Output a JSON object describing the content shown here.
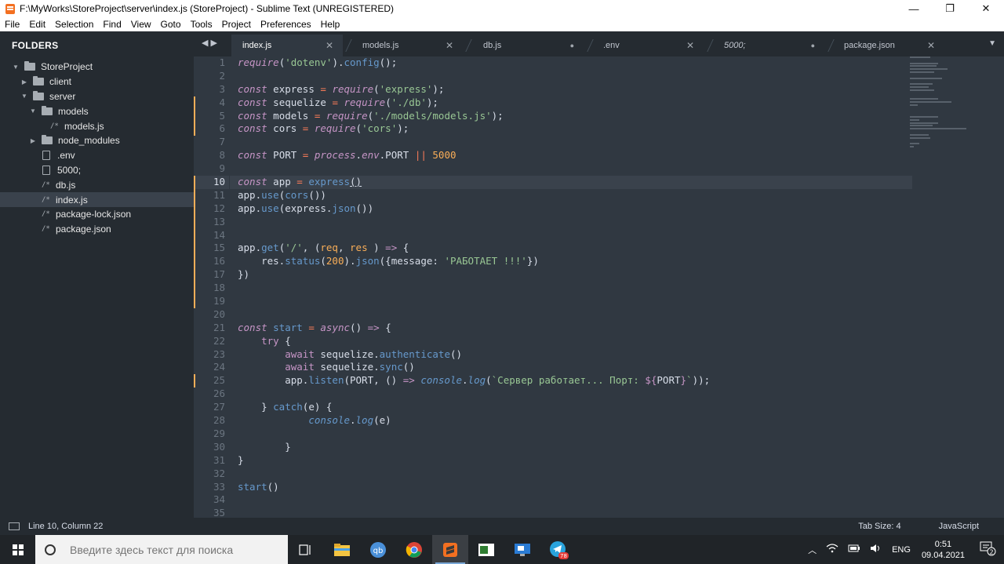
{
  "window": {
    "title": "F:\\MyWorks\\StoreProject\\server\\index.js (StoreProject) - Sublime Text (UNREGISTERED)",
    "minimize": "—",
    "restore": "❐",
    "close": "✕"
  },
  "menu": [
    "File",
    "Edit",
    "Selection",
    "Find",
    "View",
    "Goto",
    "Tools",
    "Project",
    "Preferences",
    "Help"
  ],
  "sidebar": {
    "header": "FOLDERS",
    "items": [
      {
        "label": "StoreProject",
        "type": "folder",
        "open": true,
        "indent": 0
      },
      {
        "label": "client",
        "type": "folder",
        "open": false,
        "indent": 1
      },
      {
        "label": "server",
        "type": "folder",
        "open": true,
        "indent": 1
      },
      {
        "label": "models",
        "type": "folder",
        "open": true,
        "indent": 2
      },
      {
        "label": "models.js",
        "type": "js",
        "indent": 3
      },
      {
        "label": "node_modules",
        "type": "folder",
        "open": false,
        "indent": 2
      },
      {
        "label": ".env",
        "type": "file",
        "indent": 2
      },
      {
        "label": "5000;",
        "type": "file",
        "indent": 2
      },
      {
        "label": "db.js",
        "type": "js",
        "indent": 2
      },
      {
        "label": "index.js",
        "type": "js",
        "indent": 2,
        "active": true
      },
      {
        "label": "package-lock.json",
        "type": "js",
        "indent": 2
      },
      {
        "label": "package.json",
        "type": "js",
        "indent": 2
      }
    ]
  },
  "tabs": {
    "nav": "◀ ▶",
    "dropdown": "▼",
    "items": [
      {
        "label": "index.js",
        "close": "✕",
        "active": true
      },
      {
        "label": "models.js",
        "close": "✕"
      },
      {
        "label": "db.js",
        "close": "●"
      },
      {
        "label": ".env",
        "close": "✕"
      },
      {
        "label": "5000;",
        "close": "●",
        "italic": true
      },
      {
        "label": "package.json",
        "close": "✕"
      }
    ]
  },
  "editor": {
    "line_numbers": [
      "1",
      "2",
      "3",
      "4",
      "5",
      "6",
      "7",
      "8",
      "9",
      "10",
      "11",
      "12",
      "13",
      "14",
      "15",
      "16",
      "17",
      "18",
      "19",
      "20",
      "21",
      "22",
      "23",
      "24",
      "25",
      "26",
      "27",
      "28",
      "29",
      "30",
      "31",
      "32",
      "33",
      "34",
      "35"
    ],
    "current_line": 10,
    "modified_lines": [
      4,
      5,
      6,
      10,
      11,
      12,
      13,
      14,
      15,
      16,
      17,
      18,
      19,
      25
    ]
  },
  "status": {
    "position": "Line 10, Column 22",
    "tab_size": "Tab Size: 4",
    "syntax": "JavaScript"
  },
  "taskbar": {
    "search_placeholder": "Введите здесь текст для поиска",
    "lang": "ENG",
    "time": "0:51",
    "date": "09.04.2021",
    "notif_count": "2",
    "telegram_badge": "78"
  }
}
